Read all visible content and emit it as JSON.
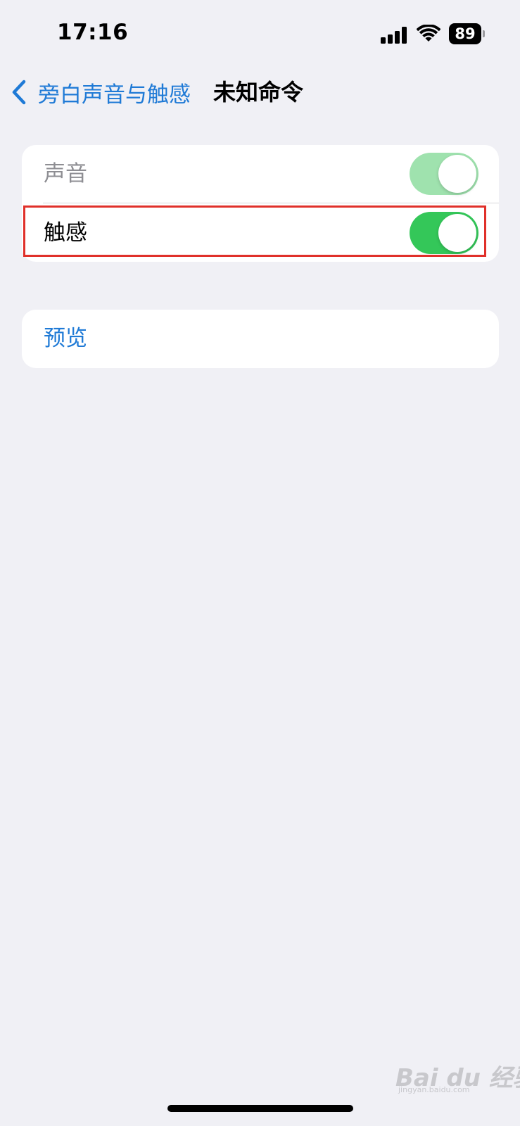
{
  "status_bar": {
    "time": "17:16",
    "battery_level": "89",
    "signal_icon": "cellular-signal-icon",
    "wifi_icon": "wifi-icon",
    "battery_icon": "battery-icon"
  },
  "nav": {
    "back_label": "旁白声音与触感",
    "back_icon": "chevron-left-icon",
    "title": "未知命令"
  },
  "group_feedback": {
    "rows": [
      {
        "label": "声音",
        "toggle_on": true,
        "dimmed": true
      },
      {
        "label": "触感",
        "toggle_on": true,
        "dimmed": false
      }
    ]
  },
  "group_preview": {
    "label": "预览"
  },
  "watermark": {
    "logo": "Bai du 经验",
    "sub": "jingyan.baidu.com"
  },
  "colors": {
    "background": "#f0f0f5",
    "accent_blue": "#1f7ad6",
    "toggle_green": "#34c759",
    "toggle_green_dimmed": "#9fe2ae",
    "highlight_red": "#e0302a"
  }
}
